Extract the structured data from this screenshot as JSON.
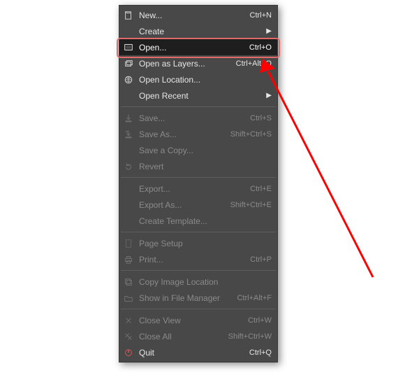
{
  "menu": {
    "groups": [
      [
        {
          "icon": "new",
          "label": "New...",
          "shortcut": "Ctrl+N"
        },
        {
          "icon": "",
          "label": "Create",
          "submenu": true
        },
        {
          "icon": "open",
          "label": "Open...",
          "shortcut": "Ctrl+O",
          "selected": true
        },
        {
          "icon": "layers",
          "label": "Open as Layers...",
          "shortcut": "Ctrl+Alt+O"
        },
        {
          "icon": "globe",
          "label": "Open Location..."
        },
        {
          "icon": "",
          "label": "Open Recent",
          "submenu": true
        }
      ],
      [
        {
          "icon": "save",
          "label": "Save...",
          "shortcut": "Ctrl+S",
          "disabled": true
        },
        {
          "icon": "saveas",
          "label": "Save As...",
          "shortcut": "Shift+Ctrl+S",
          "disabled": true
        },
        {
          "icon": "",
          "label": "Save a Copy...",
          "disabled": true
        },
        {
          "icon": "revert",
          "label": "Revert",
          "disabled": true
        }
      ],
      [
        {
          "icon": "",
          "label": "Export...",
          "shortcut": "Ctrl+E",
          "disabled": true
        },
        {
          "icon": "",
          "label": "Export As...",
          "shortcut": "Shift+Ctrl+E",
          "disabled": true
        },
        {
          "icon": "",
          "label": "Create Template...",
          "disabled": true
        }
      ],
      [
        {
          "icon": "page",
          "label": "Page Setup",
          "disabled": true
        },
        {
          "icon": "print",
          "label": "Print...",
          "shortcut": "Ctrl+P",
          "disabled": true
        }
      ],
      [
        {
          "icon": "copyloc",
          "label": "Copy Image Location",
          "disabled": true
        },
        {
          "icon": "folder",
          "label": "Show in File Manager",
          "shortcut": "Ctrl+Alt+F",
          "disabled": true
        }
      ],
      [
        {
          "icon": "close",
          "label": "Close View",
          "shortcut": "Ctrl+W",
          "disabled": true
        },
        {
          "icon": "closeall",
          "label": "Close All",
          "shortcut": "Shift+Ctrl+W",
          "disabled": true
        },
        {
          "icon": "quit",
          "label": "Quit",
          "shortcut": "Ctrl+Q"
        }
      ]
    ]
  }
}
